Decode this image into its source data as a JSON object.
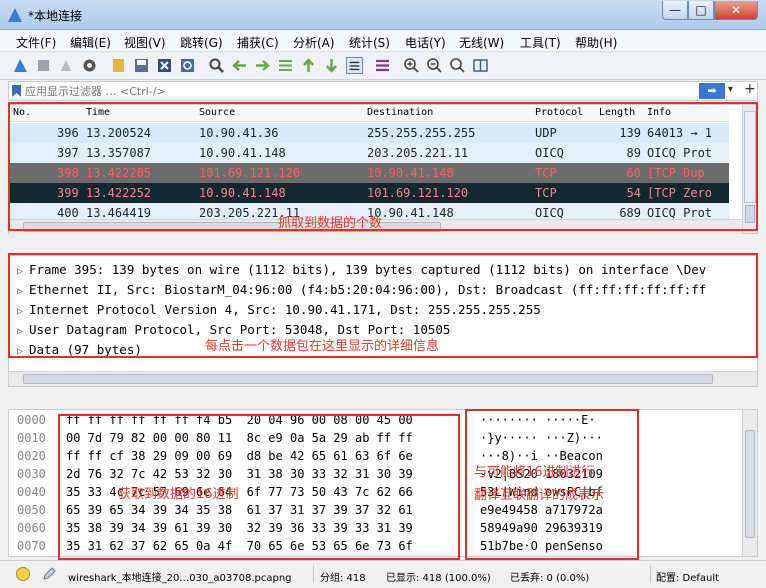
{
  "window": {
    "title": "*本地连接",
    "min": "—",
    "max": "□",
    "close": "✕"
  },
  "menu": [
    "文件(F)",
    "编辑(E)",
    "视图(V)",
    "跳转(G)",
    "捕获(C)",
    "分析(A)",
    "统计(S)",
    "电话(Y)",
    "无线(W)",
    "工具(T)",
    "帮助(H)"
  ],
  "filter": {
    "placeholder": "应用显示过滤器 … <Ctrl-/>",
    "apply": "➡",
    "dropdown": "▾",
    "add": "+"
  },
  "packet_list": {
    "headers": {
      "no": "No.",
      "time": "Time",
      "source": "Source",
      "destination": "Destination",
      "protocol": "Protocol",
      "length": "Length",
      "info": "Info"
    },
    "rows": [
      {
        "no": "396",
        "time": "13.200524",
        "source": "10.90.41.36",
        "destination": "255.255.255.255",
        "protocol": "UDP",
        "length": "139",
        "info": "64013 → 1"
      },
      {
        "no": "397",
        "time": "13.357087",
        "source": "10.90.41.148",
        "destination": "203.205.221.11",
        "protocol": "OICQ",
        "length": "89",
        "info": "OICQ Prot"
      },
      {
        "no": "398",
        "time": "13.422205",
        "source": "101.69.121.120",
        "destination": "10.90.41.148",
        "protocol": "TCP",
        "length": "60",
        "info": "[TCP Dup"
      },
      {
        "no": "399",
        "time": "13.422252",
        "source": "10.90.41.148",
        "destination": "101.69.121.120",
        "protocol": "TCP",
        "length": "54",
        "info": "[TCP Zero"
      },
      {
        "no": "400",
        "time": "13.464419",
        "source": "203.205.221.11",
        "destination": "10.90.41.148",
        "protocol": "OICQ",
        "length": "689",
        "info": "OICQ Prot"
      }
    ],
    "annotation": "抓取到数据的个数"
  },
  "details": {
    "rows": [
      "Frame 395: 139 bytes on wire (1112 bits), 139 bytes captured (1112 bits) on interface \\Dev",
      "Ethernet II, Src: BiostarM_04:96:00 (f4:b5:20:04:96:00), Dst: Broadcast (ff:ff:ff:ff:ff:ff",
      "Internet Protocol Version 4, Src: 10.90.41.171, Dst: 255.255.255.255",
      "User Datagram Protocol, Src Port: 53048, Dst Port: 10505",
      "Data (97 bytes)"
    ],
    "annotation": "每点击一个数据包在这里显示的详细信息"
  },
  "bytes": {
    "offsets": [
      "0000",
      "0010",
      "0020",
      "0030",
      "0040",
      "0050",
      "0060",
      "0070"
    ],
    "hex": [
      "ff ff ff ff ff ff f4 b5  20 04 96 00 08 00 45 00",
      "00 7d 79 82 00 00 80 11  8c e9 0a 5a 29 ab ff ff",
      "ff ff cf 38 29 09 00 69  d8 be 42 65 61 63 6f 6e",
      "2d 76 32 7c 42 53 32 30  31 38 30 33 32 31 30 39",
      "35 33 4c 7c 57 69 6e 64  6f 77 73 50 43 7c 62 66",
      "65 39 65 34 39 34 35 38  61 37 31 37 39 37 32 61",
      "35 38 39 34 39 61 39 30  32 39 36 33 39 33 31 39",
      "35 31 62 37 62 65 0a 4f  70 65 6e 53 65 6e 73 6f"
    ],
    "ascii": [
      "········ ·····E·",
      "·}y····· ···Z)···",
      "···8)··i ··Beacon",
      "-v2|BS20 18032109",
      "53L|Wind owsPC|bf",
      "e9e49458 a717972a",
      "58949a90 29639319",
      "51b7be·O penSenso"
    ],
    "annotation_hex": "获取到数据的16进制",
    "annotation_ascii_1": "与可能将16进制进行",
    "annotation_ascii_2": "翻译互联翻译的成表示"
  },
  "status": {
    "file": "wireshark_本地连接_20…030_a03708.pcapng",
    "packets": "分组: 418",
    "displayed": "已显示: 418 (100.0%)",
    "dropped": "已丢弃: 0 (0.0%)",
    "profile": "配置: Default"
  },
  "colors": {
    "annotation": "#e0302a",
    "udp_row": "#dbe8fc",
    "bad_tcp_dark": "#12272e",
    "bad_tcp_grey": "#6c6c6c"
  }
}
